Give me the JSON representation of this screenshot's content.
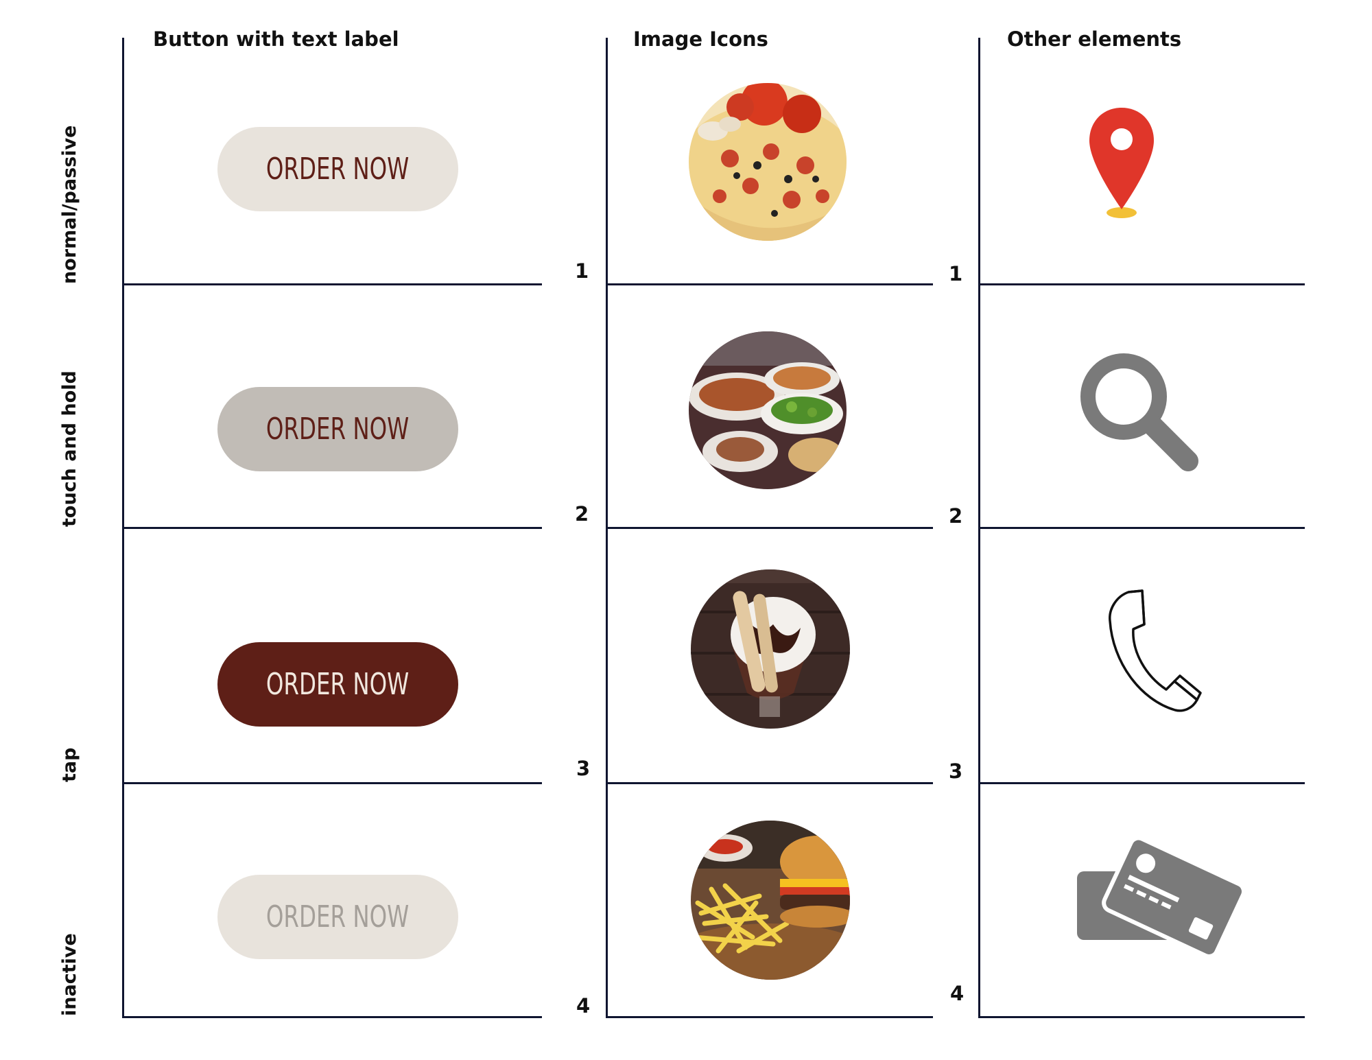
{
  "columns": {
    "buttons_header": "Button with text label",
    "image_icons_header": "Image Icons",
    "other_elements_header": "Other elements"
  },
  "rows": [
    {
      "state": "normal/passive",
      "number": "1"
    },
    {
      "state": "touch and hold",
      "number": "2"
    },
    {
      "state": "tap",
      "number": "3"
    },
    {
      "state": "inactive",
      "number": "4"
    }
  ],
  "button": {
    "label": "ORDER NOW",
    "colors": {
      "normal_bg": "#e8e3dc",
      "normal_text": "#5e1f17",
      "hold_bg": "#c1bcb6",
      "hold_text": "#5e1f17",
      "tap_bg": "#5e1f17",
      "tap_text": "#f1e8df",
      "inactive_bg": "#e8e3dc",
      "inactive_text": "#a49f99"
    }
  },
  "image_icons": [
    "pizza-image",
    "food-table-image",
    "ice-cream-sundae-image",
    "burger-fries-image"
  ],
  "other_elements": [
    "map-pin-icon",
    "search-icon",
    "phone-icon",
    "credit-cards-icon"
  ],
  "colors": {
    "line": "#0f1530",
    "pin_red": "#e0362a",
    "pin_base": "#f2c037",
    "icon_gray": "#7a7a7a"
  }
}
